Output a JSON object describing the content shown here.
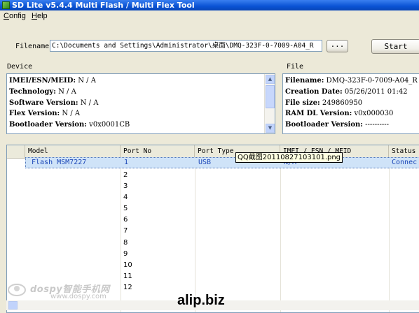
{
  "window": {
    "title": "SD Lite v5.4.4 Multi Flash / Multi Flex Tool"
  },
  "menu": {
    "items": [
      "Config",
      "Help"
    ]
  },
  "filename": {
    "label": "Filename",
    "value": "C:\\Documents and Settings\\Administrator\\桌面\\DMQ-323F-0-7009-A04_R",
    "browse_label": "...",
    "start_label": "Start"
  },
  "device": {
    "label": "Device",
    "lines": [
      {
        "key": "IMEI/ESN/MEID:",
        "value": " N / A"
      },
      {
        "key": "Technology:",
        "value": " N / A"
      },
      {
        "key": "Software Version:",
        "value": " N / A"
      },
      {
        "key": "Flex Version:",
        "value": " N / A"
      },
      {
        "key": "Bootloader Version:",
        "value": " v0x0001CB"
      }
    ]
  },
  "file": {
    "label": "File",
    "lines": [
      {
        "key": "Filename:",
        "value": " DMQ-323F-0-7009-A04_R"
      },
      {
        "key": "Creation Date:",
        "value": " 05/26/2011 01:42"
      },
      {
        "key": "File size:",
        "value": " 249860950"
      },
      {
        "key": "RAM DL Version:",
        "value": " v0x000030"
      },
      {
        "key": "Bootloader Version:",
        "value": " ----------"
      }
    ]
  },
  "table": {
    "columns": [
      "Model",
      "Port No",
      "Port Type",
      "IMEI / ESN / MEID",
      "Status"
    ],
    "selected_row": {
      "model": "Flash MSM7227",
      "port_no": "1",
      "port_type": "USB",
      "imei": "N/A",
      "status": "Connec"
    },
    "port_numbers": [
      "2",
      "3",
      "4",
      "5",
      "6",
      "7",
      "8",
      "9",
      "10",
      "11",
      "12"
    ]
  },
  "tooltip": "QQ截图20110827103101.png",
  "watermarks": {
    "site_cn": "dospy智能手机网",
    "site_url": "www.dospy.com",
    "alip": "alip.biz"
  },
  "colors": {
    "title_bar": "#0a53d4",
    "selection": "#cfe3f8",
    "selection_text": "#1b46b7"
  }
}
